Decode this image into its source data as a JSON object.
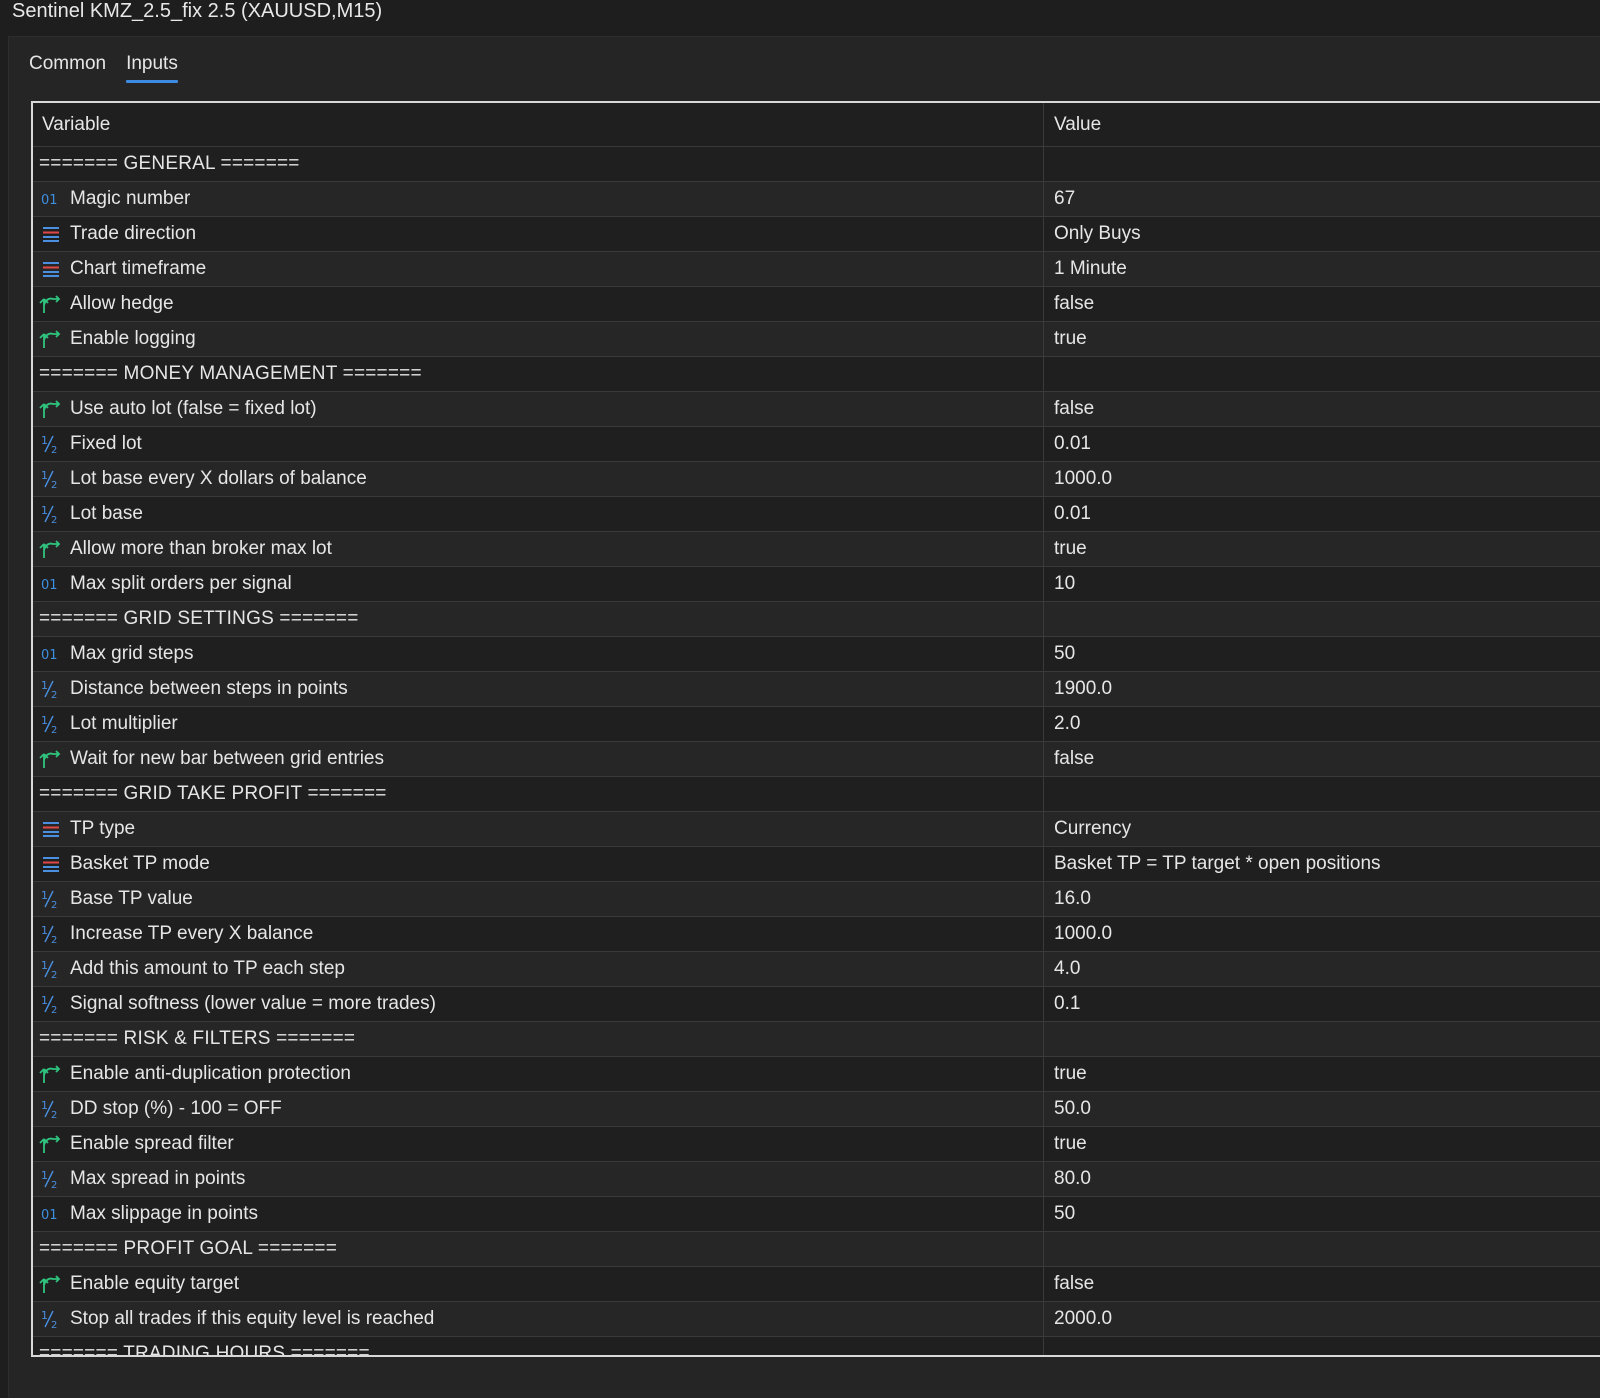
{
  "window": {
    "title": "Sentinel KMZ_2.5_fix 2.5 (XAUUSD,M15)"
  },
  "tabs": [
    {
      "label": "Common",
      "active": false
    },
    {
      "label": "Inputs",
      "active": true
    }
  ],
  "table": {
    "headers": {
      "variable": "Variable",
      "value": "Value"
    },
    "rows": [
      {
        "kind": "section",
        "variable": "=======  GENERAL  =======",
        "value": ""
      },
      {
        "kind": "int",
        "icon": "integer-icon",
        "variable": "Magic number",
        "value": "67"
      },
      {
        "kind": "enum",
        "icon": "enum-icon",
        "variable": "Trade direction",
        "value": "Only Buys"
      },
      {
        "kind": "enum",
        "icon": "enum-icon",
        "variable": "Chart timeframe",
        "value": "1 Minute"
      },
      {
        "kind": "bool",
        "icon": "boolean-icon",
        "variable": "Allow hedge",
        "value": "false"
      },
      {
        "kind": "bool",
        "icon": "boolean-icon",
        "variable": "Enable logging",
        "value": "true"
      },
      {
        "kind": "section",
        "variable": "=======  MONEY MANAGEMENT  =======",
        "value": ""
      },
      {
        "kind": "bool",
        "icon": "boolean-icon",
        "variable": "Use auto lot (false = fixed lot)",
        "value": "false"
      },
      {
        "kind": "double",
        "icon": "double-icon",
        "variable": "Fixed lot",
        "value": "0.01"
      },
      {
        "kind": "double",
        "icon": "double-icon",
        "variable": "Lot base every X dollars of balance",
        "value": "1000.0"
      },
      {
        "kind": "double",
        "icon": "double-icon",
        "variable": "Lot base",
        "value": "0.01"
      },
      {
        "kind": "bool",
        "icon": "boolean-icon",
        "variable": "Allow more than broker max lot",
        "value": "true"
      },
      {
        "kind": "int",
        "icon": "integer-icon",
        "variable": "Max split orders per signal",
        "value": "10"
      },
      {
        "kind": "section",
        "variable": "=======  GRID SETTINGS  =======",
        "value": ""
      },
      {
        "kind": "int",
        "icon": "integer-icon",
        "variable": "Max grid steps",
        "value": "50"
      },
      {
        "kind": "double",
        "icon": "double-icon",
        "variable": "Distance between steps in points",
        "value": "1900.0"
      },
      {
        "kind": "double",
        "icon": "double-icon",
        "variable": "Lot multiplier",
        "value": "2.0"
      },
      {
        "kind": "bool",
        "icon": "boolean-icon",
        "variable": "Wait for new bar between grid entries",
        "value": "false"
      },
      {
        "kind": "section",
        "variable": "=======  GRID TAKE PROFIT  =======",
        "value": ""
      },
      {
        "kind": "enum",
        "icon": "enum-icon",
        "variable": "TP type",
        "value": "Currency"
      },
      {
        "kind": "enum",
        "icon": "enum-icon",
        "variable": "Basket TP mode",
        "value": "Basket TP = TP target * open positions"
      },
      {
        "kind": "double",
        "icon": "double-icon",
        "variable": "Base TP value",
        "value": "16.0"
      },
      {
        "kind": "double",
        "icon": "double-icon",
        "variable": "Increase TP every X balance",
        "value": "1000.0"
      },
      {
        "kind": "double",
        "icon": "double-icon",
        "variable": "Add this amount to TP each step",
        "value": "4.0"
      },
      {
        "kind": "double",
        "icon": "double-icon",
        "variable": "Signal softness (lower value = more trades)",
        "value": "0.1"
      },
      {
        "kind": "section",
        "variable": "=======  RISK & FILTERS  =======",
        "value": ""
      },
      {
        "kind": "bool",
        "icon": "boolean-icon",
        "variable": "Enable anti-duplication protection",
        "value": "true"
      },
      {
        "kind": "double",
        "icon": "double-icon",
        "variable": "DD stop (%) - 100 = OFF",
        "value": "50.0"
      },
      {
        "kind": "bool",
        "icon": "boolean-icon",
        "variable": "Enable spread filter",
        "value": "true"
      },
      {
        "kind": "double",
        "icon": "double-icon",
        "variable": "Max spread in points",
        "value": "80.0"
      },
      {
        "kind": "int",
        "icon": "integer-icon",
        "variable": "Max slippage in points",
        "value": "50"
      },
      {
        "kind": "section",
        "variable": "=======  PROFIT GOAL  =======",
        "value": ""
      },
      {
        "kind": "bool",
        "icon": "boolean-icon",
        "variable": "Enable equity target",
        "value": "false"
      },
      {
        "kind": "double",
        "icon": "double-icon",
        "variable": "Stop all trades if this equity level is reached",
        "value": "2000.0"
      },
      {
        "kind": "section",
        "variable": "=======  TRADING HOURS  =======",
        "value": ""
      }
    ]
  },
  "colors": {
    "background": "#1e1e1e",
    "panel": "#252526",
    "tab_underline": "#3c8be0",
    "integer_icon": "#3d8fe0",
    "enum_icon_blue": "#4a8fe0",
    "enum_icon_red": "#e04848",
    "boolean_icon": "#2fc47e",
    "double_icon": "#4a8fe0"
  }
}
